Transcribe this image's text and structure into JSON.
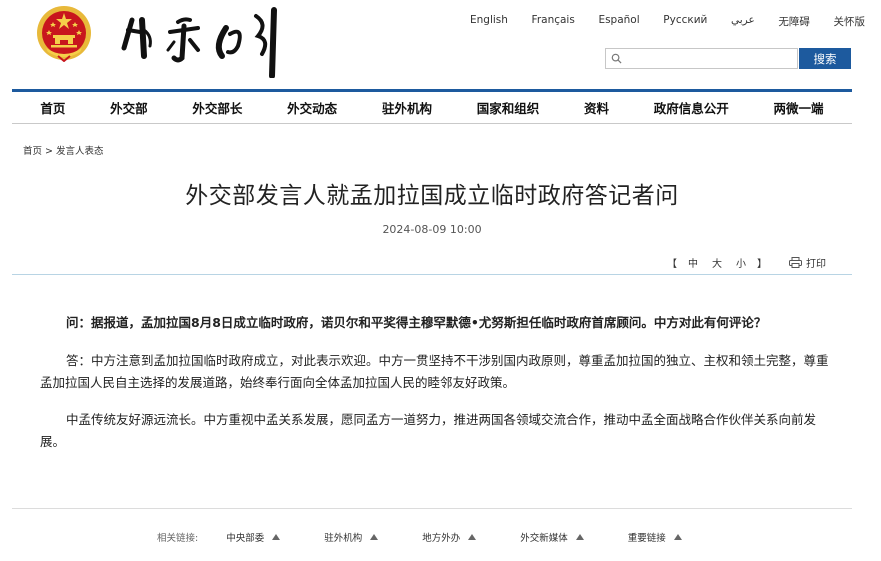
{
  "header": {
    "languages": [
      "English",
      "Français",
      "Español",
      "Русский",
      "عربي",
      "无障碍",
      "关怀版"
    ],
    "search": {
      "placeholder": "",
      "button_label": "搜索"
    }
  },
  "nav": [
    "首页",
    "外交部",
    "外交部长",
    "外交动态",
    "驻外机构",
    "国家和组织",
    "资料",
    "政府信息公开",
    "两微一端"
  ],
  "breadcrumb": {
    "home": "首页",
    "sep": ">",
    "current": "发言人表态"
  },
  "article": {
    "title": "外交部发言人就孟加拉国成立临时政府答记者问",
    "date": "2024-08-09 10:00",
    "font_tools": {
      "open": "【",
      "sizes": [
        "中",
        "大",
        "小"
      ],
      "close": "】",
      "print": "打印"
    },
    "paragraphs": [
      "问：据报道，孟加拉国8月8日成立临时政府，诺贝尔和平奖得主穆罕默德•尤努斯担任临时政府首席顾问。中方对此有何评论？",
      "答：中方注意到孟加拉国临时政府成立，对此表示欢迎。中方一贯坚持不干涉别国内政原则，尊重孟加拉国的独立、主权和领土完整，尊重孟加拉国人民自主选择的发展道路，始终奉行面向全体孟加拉国人民的睦邻友好政策。",
      "中孟传统友好源远流长。中方重视中孟关系发展，愿同孟方一道努力，推进两国各领域交流合作，推动中孟全面战略合作伙伴关系向前发展。"
    ]
  },
  "footer": {
    "label": "相关链接:",
    "links": [
      "中央部委",
      "驻外机构",
      "地方外办",
      "外交新媒体",
      "重要链接"
    ]
  },
  "colors": {
    "accent": "#1d5a9e",
    "divider": "#b8d4e4"
  }
}
